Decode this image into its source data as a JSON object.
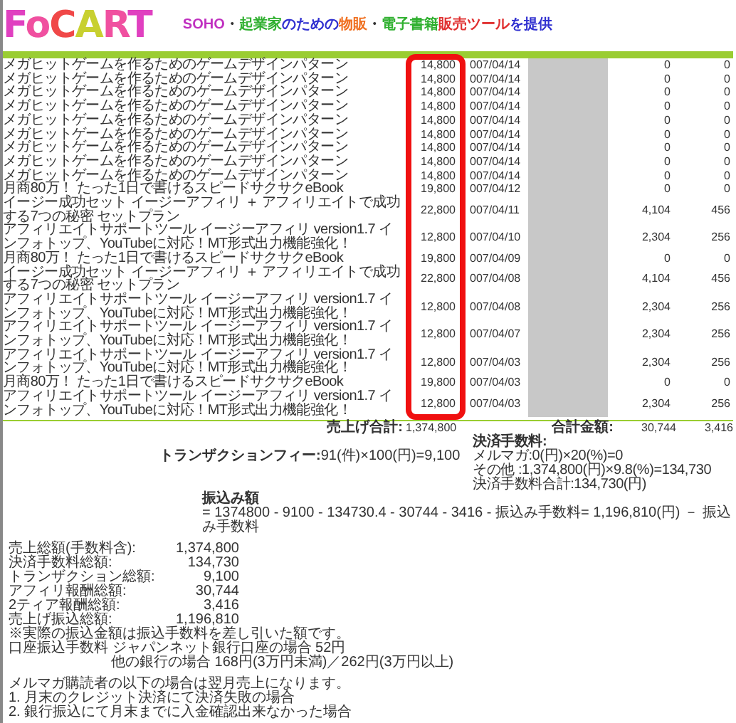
{
  "header": {
    "logo_letters": [
      {
        "char": "F",
        "color": "#e040c0"
      },
      {
        "char": "o",
        "color": "#f050a0"
      },
      {
        "char": "C",
        "color": "#f04848"
      },
      {
        "char": "A",
        "color": "#c8d030"
      },
      {
        "char": "R",
        "color": "#f050a0"
      },
      {
        "char": "T",
        "color": "#e040c0"
      }
    ],
    "tagline": [
      {
        "text": "SOHO",
        "color": "#c030c0"
      },
      {
        "text": "・",
        "color": "#303030"
      },
      {
        "text": "起業家",
        "color": "#30b030"
      },
      {
        "text": "のための",
        "color": "#3030d0"
      },
      {
        "text": "物販",
        "color": "#f07020"
      },
      {
        "text": "・",
        "color": "#303030"
      },
      {
        "text": "電子書籍",
        "color": "#30b030"
      },
      {
        "text": "販売ツール",
        "color": "#e03030"
      },
      {
        "text": "を提供",
        "color": "#3030d0"
      }
    ]
  },
  "rows": [
    {
      "product": "メガヒットゲームを作るためのゲームデザインパターン",
      "price": "14,800",
      "date": "007/04/14",
      "column_5": "0",
      "column_6": "0"
    },
    {
      "product": "メガヒットゲームを作るためのゲームデザインパターン",
      "price": "14,800",
      "date": "007/04/14",
      "column_5": "0",
      "column_6": "0"
    },
    {
      "product": "メガヒットゲームを作るためのゲームデザインパターン",
      "price": "14,800",
      "date": "007/04/14",
      "column_5": "0",
      "column_6": "0"
    },
    {
      "product": "メガヒットゲームを作るためのゲームデザインパターン",
      "price": "14,800",
      "date": "007/04/14",
      "column_5": "0",
      "column_6": "0"
    },
    {
      "product": "メガヒットゲームを作るためのゲームデザインパターン",
      "price": "14,800",
      "date": "007/04/14",
      "column_5": "0",
      "column_6": "0"
    },
    {
      "product": "メガヒットゲームを作るためのゲームデザインパターン",
      "price": "14,800",
      "date": "007/04/14",
      "column_5": "0",
      "column_6": "0"
    },
    {
      "product": "メガヒットゲームを作るためのゲームデザインパターン",
      "price": "14,800",
      "date": "007/04/14",
      "column_5": "0",
      "column_6": "0"
    },
    {
      "product": "メガヒットゲームを作るためのゲームデザインパターン",
      "price": "14,800",
      "date": "007/04/14",
      "column_5": "0",
      "column_6": "0"
    },
    {
      "product": "メガヒットゲームを作るためのゲームデザインパターン",
      "price": "14,800",
      "date": "007/04/14",
      "column_5": "0",
      "column_6": "0"
    },
    {
      "product": "月商80万！ たった1日で書けるスピードサクサクeBook",
      "price": "19,800",
      "date": "007/04/12",
      "column_5": "0",
      "column_6": "0"
    },
    {
      "product": "イージー成功セット イージーアフィリ ＋ アフィリエイトで成功する7つの秘密 セットプラン",
      "price": "22,800",
      "date": "007/04/11",
      "column_5": "4,104",
      "column_6": "456"
    },
    {
      "product": "アフィリエイトサポートツール イージーアフィリ version1.7 インフォトップ、YouTubeに対応！MT形式出力機能強化！",
      "price": "12,800",
      "date": "007/04/10",
      "column_5": "2,304",
      "column_6": "256"
    },
    {
      "product": "月商80万！ たった1日で書けるスピードサクサクeBook",
      "price": "19,800",
      "date": "007/04/09",
      "column_5": "0",
      "column_6": "0"
    },
    {
      "product": "イージー成功セット イージーアフィリ ＋ アフィリエイトで成功する7つの秘密 セットプラン",
      "price": "22,800",
      "date": "007/04/08",
      "column_5": "4,104",
      "column_6": "456"
    },
    {
      "product": "アフィリエイトサポートツール イージーアフィリ version1.7 インフォトップ、YouTubeに対応！MT形式出力機能強化！",
      "price": "12,800",
      "date": "007/04/08",
      "column_5": "2,304",
      "column_6": "256"
    },
    {
      "product": "アフィリエイトサポートツール イージーアフィリ version1.7 インフォトップ、YouTubeに対応！MT形式出力機能強化！",
      "price": "12,800",
      "date": "007/04/07",
      "column_5": "2,304",
      "column_6": "256"
    },
    {
      "product": "アフィリエイトサポートツール イージーアフィリ version1.7 インフォトップ、YouTubeに対応！MT形式出力機能強化！",
      "price": "12,800",
      "date": "007/04/03",
      "column_5": "2,304",
      "column_6": "256"
    },
    {
      "product": "月商80万！ たった1日で書けるスピードサクサクeBook",
      "price": "19,800",
      "date": "007/04/03",
      "column_5": "0",
      "column_6": "0"
    },
    {
      "product": "アフィリエイトサポートツール イージーアフィリ version1.7 インフォトップ、YouTubeに対応！MT形式出力機能強化！",
      "price": "12,800",
      "date": "007/04/03",
      "column_5": "2,304",
      "column_6": "256"
    }
  ],
  "totals": {
    "sales_label": "売上げ合計:",
    "sales_value": "1,374,800",
    "amount_label": "合計金額:",
    "amount_values": [
      "30,744",
      "3,416"
    ],
    "fee_label": "決済手数料:",
    "fee_lines": [
      "メルマガ:0(円)×20(%)=0",
      "その他 :1,374,800(円)×9.8(%)=134,730",
      "決済手数料合計:134,730(円)"
    ],
    "transaction_label": "トランザクションフィー:",
    "transaction_value": "91(件)×100(円)=9,100",
    "transfer_label": "振込み額",
    "transfer_formula": "= 1374800 - 9100 - 134730.4 - 30744 - 3416 - 振込み手数料= 1,196,810(円) － 振込み手数料"
  },
  "summary": [
    {
      "label": "売上総額(手数料含):",
      "value": "1,374,800"
    },
    {
      "label": "決済手数料総額:",
      "value": "134,730"
    },
    {
      "label": "トランザクション総額:",
      "value": "9,100"
    },
    {
      "label": "アフィリ報酬総額:",
      "value": "30,744"
    },
    {
      "label": "2ティア報酬総額:",
      "value": "3,416"
    },
    {
      "label": "売上げ振込総額:",
      "value": "1,196,810"
    }
  ],
  "notes": [
    "※実際の振込金額は振込手数料を差し引いた額です。",
    "口座振込手数料 ジャパンネット銀行口座の場合 52円"
  ],
  "note_indented": "他の銀行の場合 168円(3万円未満)／262円(3万円以上)",
  "mail_notes": [
    "メルマガ購読者の以下の場合は翌月売上になります。",
    "1. 月末のクレジット決済にて決済失敗の場合",
    "2. 銀行振込にて月末までに入金確認出来なかった場合"
  ]
}
